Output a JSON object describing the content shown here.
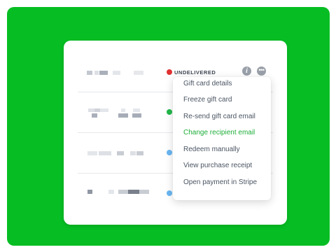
{
  "colors": {
    "background": "#06bd23",
    "card": "#ffffff",
    "status_undelivered": "#e03131",
    "status_delivered": "#22b84a",
    "status_pending": "#6ab7f2",
    "menu_active": "#1fae3a"
  },
  "orders": [
    {
      "status": "undelivered",
      "status_label": "UNDELIVERED",
      "icons": [
        "info-icon",
        "more-options-icon"
      ]
    },
    {
      "status": "delivered",
      "status_label": ""
    },
    {
      "status": "pending",
      "status_label": ""
    },
    {
      "status": "pending",
      "status_label": ""
    }
  ],
  "context_menu": {
    "items": [
      {
        "label": "Gift card details"
      },
      {
        "label": "Freeze gift card"
      },
      {
        "label": "Re-send gift card email"
      },
      {
        "label": "Change recipient email",
        "highlighted": true
      },
      {
        "label": "Redeem manually"
      },
      {
        "label": "View purchase receipt"
      },
      {
        "label": "Open payment in Stripe"
      }
    ]
  }
}
